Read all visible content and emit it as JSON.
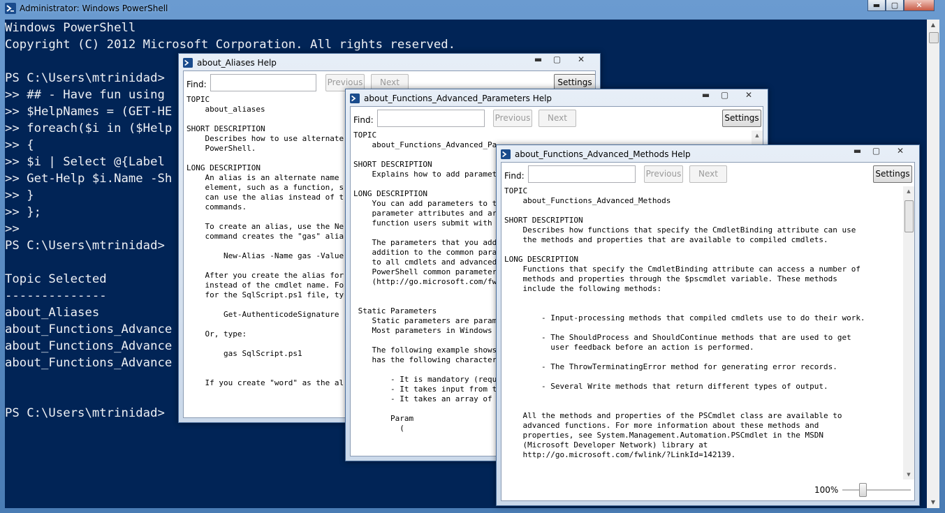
{
  "ps": {
    "title": "Administrator: Windows PowerShell",
    "minimize": "▬",
    "maximize": "▢",
    "close": "✕",
    "console_lines": [
      "Windows PowerShell",
      "Copyright (C) 2012 Microsoft Corporation. All rights reserved.",
      "",
      "PS C:\\Users\\mtrinidad>",
      ">> ## - Have fun using",
      ">> $HelpNames = (GET-HE",
      ">> foreach($i in ($Help",
      ">> {",
      ">> $i | Select @{Label",
      ">> Get-Help $i.Name -Sh",
      ">> }",
      ">> };",
      ">>",
      "PS C:\\Users\\mtrinidad>",
      "",
      "Topic Selected",
      "--------------",
      "about_Aliases",
      "about_Functions_Advance",
      "about_Functions_Advance",
      "about_Functions_Advance",
      "",
      "",
      "PS C:\\Users\\mtrinidad>"
    ]
  },
  "find": {
    "label": "Find:",
    "previous": "Previous",
    "next": "Next",
    "settings": "Settings"
  },
  "help1": {
    "title": "about_Aliases Help",
    "text": "TOPIC\n    about_aliases\n\nSHORT DESCRIPTION\n    Describes how to use alternate\n    PowerShell.\n\nLONG DESCRIPTION\n    An alias is an alternate name\n    element, such as a function, s\n    can use the alias instead of t\n    commands.\n\n    To create an alias, use the Ne\n    command creates the \"gas\" alia\n\n        New-Alias -Name gas -Value\n\n    After you create the alias for\n    instead of the cmdlet name. Fo\n    for the SqlScript.ps1 file, ty\n\n        Get-AuthenticodeSignature\n\n    Or, type:\n\n        gas SqlScript.ps1\n\n\n    If you create \"word\" as the al"
  },
  "help2": {
    "title": "about_Functions_Advanced_Parameters Help",
    "text": "TOPIC\n    about_Functions_Advanced_Pa\n\nSHORT DESCRIPTION\n    Explains how to add paramet\n\nLONG DESCRIPTION\n    You can add parameters to t\n    parameter attributes and ar\n    function users submit with\n\n    The parameters that you add\n    addition to the common para\n    to all cmdlets and advanced\n    PowerShell common parameter\n    (http://go.microsoft.com/fw\n\n\n Static Parameters\n    Static parameters are param\n    Most parameters in Windows\n\n    The following example shows\n    has the following character\n\n        - It is mandatory (requ\n        - It takes input from t\n        - It takes an array of\n\n        Param\n          ("
  },
  "help3": {
    "title": "about_Functions_Advanced_Methods Help",
    "text": "TOPIC\n    about_Functions_Advanced_Methods\n\nSHORT DESCRIPTION\n    Describes how functions that specify the CmdletBinding attribute can use\n    the methods and properties that are available to compiled cmdlets.\n\nLONG DESCRIPTION\n    Functions that specify the CmdletBinding attribute can access a number of\n    methods and properties through the $pscmdlet variable. These methods\n    include the following methods:\n\n\n        - Input-processing methods that compiled cmdlets use to do their work.\n\n        - The ShouldProcess and ShouldContinue methods that are used to get\n          user feedback before an action is performed.\n\n        - The ThrowTerminatingError method for generating error records.\n\n        - Several Write methods that return different types of output.\n\n\n    All the methods and properties of the PSCmdlet class are available to\n    advanced functions. For more information about these methods and\n    properties, see System.Management.Automation.PSCmdlet in the MSDN\n    (Microsoft Developer Network) library at\n    http://go.microsoft.com/fwlink/?LinkId=142139.",
    "zoom": "100%",
    "zoom_level": 0.3
  },
  "icons": {
    "powershell": "powershell-icon"
  },
  "colors": {
    "console_bg": "#012456",
    "console_fg": "#eef0f4"
  }
}
